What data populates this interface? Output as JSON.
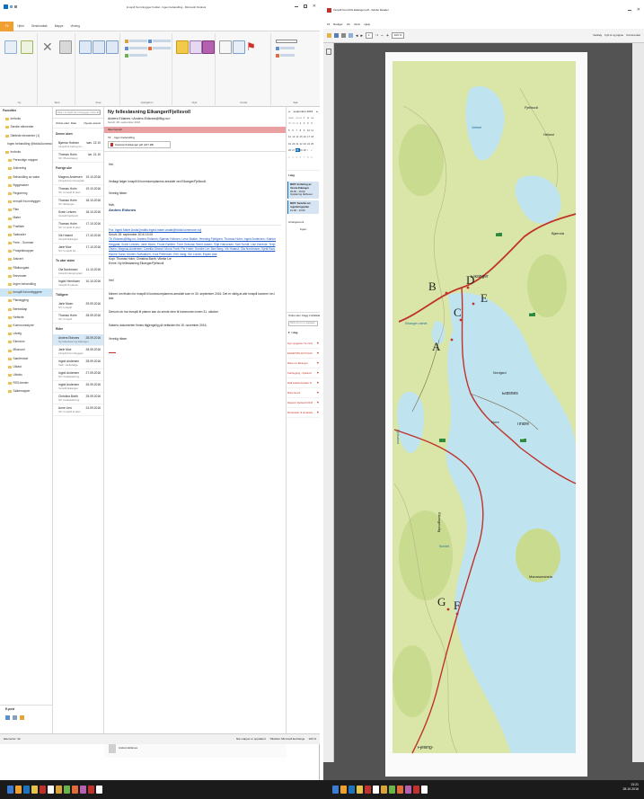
{
  "outlook": {
    "window_title": "Innspill fra Innbygger Foldal - Ingen behandling - Microsoft Outlook",
    "tabs": [
      "Fil",
      "Hjem",
      "Send/mottak",
      "Mappe",
      "Visning"
    ],
    "ribbon_groups": [
      "Ny",
      "Slett",
      "Svar",
      "Hurtigtrinn",
      "Flytt",
      "Koder",
      "Søk"
    ],
    "nav": {
      "favorites_header": "Favoritter",
      "items": [
        "Innboks",
        "Sendte elementer",
        "Slettede elementer (1)",
        "Ingen behandling @foldal.kommune.no",
        "Innboks",
        "Personlige mapper",
        "Arkivering",
        "Behandling av saker",
        "Byggesaker",
        "Regulering",
        "Innspill fra innbygger",
        "Plan",
        "Møter",
        "Postliste",
        "Søknader",
        "Ferie - Sommer",
        "Prosjektmapper",
        "Arkivert",
        "Rådhusgata",
        "Brevmaler",
        "Ingen behandling",
        "Innspill fra innbyggere",
        "Planlegging",
        "Beredskap",
        "Nettside",
        "Kommunestyret",
        "Utvalg",
        "Eiendom",
        "Økonomi",
        "Samferdsel",
        "Utkast",
        "Utboks",
        "RSS-feeder",
        "Søkemapper"
      ],
      "mail_label": "E-post",
      "calendar_label": "Kalender",
      "contacts_label": "Kontakter",
      "tasks_label": "Oppgaver"
    },
    "message_list": {
      "search_placeholder": "Søk i Innspill fra Innbygger (Ctrl+E)",
      "sort_label": "Ordne etter: Dato",
      "sort_order": "Nyeste øverst",
      "groups": [
        {
          "label": "Denne uken",
          "items": [
            {
              "sender": "Bjørnar Holmen",
              "date": "søn. 22.10",
              "subject": "Innspill til høring for..."
            },
            {
              "sender": "Thomas Holm",
              "date": "lør. 21.10",
              "subject": "SV: Planstrategi"
            }
          ]
        },
        {
          "label": "Forrige uke",
          "items": [
            {
              "sender": "Magnus Andersen",
              "date": "19.10.2016",
              "subject": "Innspill kommuneplan"
            },
            {
              "sender": "Thomas Holm",
              "date": "19.10.2016",
              "subject": "SV: Innspill til plan"
            },
            {
              "sender": "Thomas Holm",
              "date": "18.10.2016",
              "subject": "SV: Eikanger..."
            },
            {
              "sender": "Svein Leknes",
              "date": "18.10.2016",
              "subject": "Innspill Fjellsvoll"
            },
            {
              "sender": "Thomas Holm",
              "date": "17.10.2016",
              "subject": "SV: Innspill til plan"
            },
            {
              "sender": "Vik Holand",
              "date": "17.10.2016",
              "subject": "Innspill Eikanger"
            },
            {
              "sender": "Jarle Moe",
              "date": "17.10.2016",
              "subject": "SV: Innspill fra ..."
            }
          ]
        },
        {
          "label": "To uker siden",
          "items": [
            {
              "sender": "Ola Nordmann",
              "date": "11.10.2016",
              "subject": "Innspill planprogram"
            },
            {
              "sender": "Ingrid Henriksen",
              "date": "10.10.2016",
              "subject": "Innspill til planen"
            }
          ]
        },
        {
          "label": "Tidligere",
          "items": [
            {
              "sender": "Jarle Moen",
              "date": "29.09.2016",
              "subject": "SV: innspill"
            },
            {
              "sender": "Thomas Holm",
              "date": "28.09.2016",
              "subject": "SV: Innspill"
            }
          ]
        },
        {
          "label": "Eldre",
          "items": [
            {
              "sender": "Anders Eidsnes",
              "date": "28.09.2016",
              "subject": "Ny fellesløsning Eikanger"
            },
            {
              "sender": "Jarle Moe",
              "date": "28.09.2016",
              "subject": "Innspill fra innbygger"
            },
            {
              "sender": "Ingrid Andersen",
              "date": "28.09.2016",
              "subject": "Vedr. rekkefølge"
            },
            {
              "sender": "Ingrid Andersen",
              "date": "27.09.2016",
              "subject": "SV: Fellesløsning"
            },
            {
              "sender": "Ingrid Andersen",
              "date": "26.09.2016",
              "subject": "Innspill Eikanger"
            },
            {
              "sender": "Christina Barth",
              "date": "25.09.2016",
              "subject": "SV: Fellesløsning"
            },
            {
              "sender": "Anne Lien",
              "date": "24.09.2016",
              "subject": "SV: Innspill til plan"
            }
          ]
        }
      ]
    },
    "reading": {
      "subject": "Ny fellesløsning Eikanger/Fjellsvoll",
      "from": "Anders Eidsnes <Anders.Eidsnes@lfkg.no>",
      "sent": "Sendt: 28. september 2016",
      "banner": "Ikke besvart",
      "to_label": "Til:",
      "to_value": "Ingen behandling",
      "attachment": "Kartutsnitt Eikanger.pdf (227 kB)",
      "greeting": "Hei,",
      "body1": "Vedlagt følger innspill til kommuneplanens arealdel ved Eikanger/Fjellsvoll.",
      "closing1": "Vennlig hilsen",
      "signoff": "Mvh,",
      "signature": "Anders Eidsnes",
      "from_line": "Fra: Ingrid Marie Andal [mailto:ingrid.marie.andal@foldal.kommune.no]",
      "sent_line": "Sendt: 28. september 2016 13:05",
      "to_line": "Til: Eidsnes@lfkg.no; Anders Eidsnes; Bjørnar Holmen; Lene Bakke; Henning Fjellgren; Thomas Holm; Ingrid Andersen; Katrine Heggdal; Svein Leknes; Jarle Moen; Frode Rørlien; Tone Gravdal; Bernt Aasen; Silje Halvorsen; Kari Nordli; Lise Hareide; Terje Olsen; Magnus Andersen; Camilla Strand; Mona Tveit; Per Holm; Sondre Lie; Åse Berg; Vik Holand; Ola Nordmann; Kjetil Rød; Hanne Sund; Morten Solbakken; Knut Pettersen; Erik Vang; Siri Lunde; Espen Aas",
      "cc_line": "Kopi: Thomas Holm; Christina Barth; Vibeke Lie",
      "subject_line": "Emne: Ny fellesløsning Eikanger/Fjellsvoll",
      "body2": "Hei!",
      "body3": "Minner om fristen for innspill til kommuneplanens arealdel som er 30. september 2016. Det er viktig at alle innspill kommer inn i tide.",
      "body4": "Dersom du har innspill til planen kan du sende dem til kommunen innen 31. oktober.",
      "body5": "Sakens dokumenter finnes tilgjengelig på nettsiden fra 15. november 2016.",
      "closing2": "Vennlig hilsen",
      "footer_contact": "Anders Eidsnes"
    },
    "todo": {
      "month": "september 2016",
      "weekdays": [
        "ma",
        "ti",
        "on",
        "to",
        "fr",
        "lø",
        "sø"
      ],
      "days": [
        "29",
        "30",
        "31",
        "1",
        "2",
        "3",
        "4",
        "5",
        "6",
        "7",
        "8",
        "9",
        "10",
        "11",
        "12",
        "13",
        "14",
        "15",
        "16",
        "17",
        "18",
        "19",
        "20",
        "21",
        "22",
        "23",
        "24",
        "25",
        "26",
        "27",
        "28",
        "29",
        "30",
        "1",
        "2",
        "3",
        "4",
        "5",
        "6",
        "7",
        "8",
        "9"
      ],
      "today_label": "I dag",
      "appointments": [
        {
          "title": "MØT: Innføring av Vestre Eikanger",
          "time": "09:00 - 10:00",
          "place": "Opplæring rådhuset"
        },
        {
          "title": "MØT: Samråd om reguleringsplan",
          "time": "12:00 - 13:00",
          "place": ""
        }
      ],
      "arrange_label": "Arrangement",
      "arrange_value": "Ingen",
      "tasks_header": "Ordne etter: Flagg: Forfallsdato",
      "task_placeholder": "Skriv inn en ny oppgave",
      "tasks_today": "I dag",
      "tasks": [
        "Nye oppgaver fra innbyggerne",
        "ENHETSPLAN KVALITET",
        "Møte om Eikanger",
        "Kartlegging - Fjellsvoll",
        "Mail saksbehandler til",
        "Møte Hevik",
        "Rapport Fjellsvoll 2016 11",
        "Merknader til arealdelen"
      ]
    },
    "status": {
      "left": "Elementer: 32",
      "right": "Alle mapper er oppdatert.",
      "server": "Tilkoblet: Microsoft Exchange",
      "zoom": "100 %"
    }
  },
  "adobe": {
    "window_title": "Innspill fra LFKG Eikanger.pdf - Adobe Reader",
    "menu": [
      "Fil",
      "Rediger",
      "Vis",
      "Vindu",
      "Hjelp"
    ],
    "page_number": "1",
    "page_total": "/ 1",
    "zoom": "100 %",
    "tools_label": "Verktøy",
    "fill_sign_label": "Fyll ut og signer",
    "comment_label": "Kommentar",
    "map_labels": {
      "A": "A",
      "B": "B",
      "C": "C",
      "D": "D",
      "E": "E",
      "F": "F",
      "G": "G",
      "places": [
        "Eikanger",
        "Eidsnes",
        "Nore",
        "Tindre",
        "Eikangervåg",
        "Mannsnesheia",
        "Fjellsvoll",
        "Vatnet",
        "Bjørnda",
        "Eikanger-vatnet",
        "Fjellvatnet",
        "Nordgard",
        "Helland",
        "Sundet",
        "Fjelling-"
      ],
      "road_numbers": [
        "57",
        "569",
        "383"
      ]
    }
  },
  "taskbar": {
    "clock_time": "13:21",
    "clock_date": "28.10.2016"
  },
  "colors": {
    "outlook_file_tab": "#f0a030",
    "selection_blue": "#cde6f7",
    "banner_red": "#e8a0a0",
    "link_blue": "#1a57c4",
    "map_land": "#d9e6a8",
    "map_water": "#bfe3ef",
    "map_road": "#c0322b",
    "adobe_bg": "#535353",
    "taskbar_bg": "#1b1b1b"
  }
}
